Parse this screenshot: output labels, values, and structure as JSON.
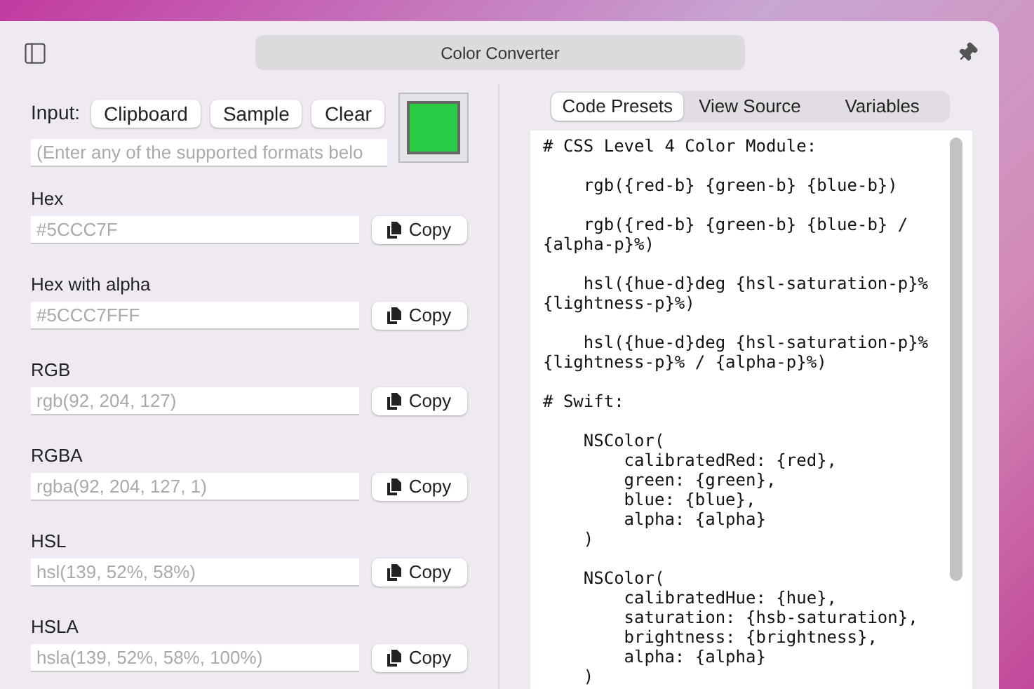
{
  "window": {
    "title": "Color Converter"
  },
  "input": {
    "label": "Input:",
    "buttons": [
      "Clipboard",
      "Sample",
      "Clear"
    ],
    "placeholder": "(Enter any of the supported formats belo",
    "color": "#29cc44"
  },
  "formats": [
    {
      "label": "Hex",
      "placeholder": "#5CCC7F",
      "button": "Copy"
    },
    {
      "label": "Hex with alpha",
      "placeholder": "#5CCC7FFF",
      "button": "Copy"
    },
    {
      "label": "RGB",
      "placeholder": "rgb(92, 204, 127)",
      "button": "Copy"
    },
    {
      "label": "RGBA",
      "placeholder": "rgba(92, 204, 127, 1)",
      "button": "Copy"
    },
    {
      "label": "HSL",
      "placeholder": "hsl(139, 52%, 58%)",
      "button": "Copy"
    },
    {
      "label": "HSLA",
      "placeholder": "hsla(139, 52%, 58%, 100%)",
      "button": "Copy"
    }
  ],
  "tabs": [
    {
      "label": "Code Presets",
      "selected": true
    },
    {
      "label": "View Source",
      "selected": false
    },
    {
      "label": "Variables",
      "selected": false
    }
  ],
  "code": "# CSS Level 4 Color Module:\n\n    rgb({red-b} {green-b} {blue-b})\n\n    rgb({red-b} {green-b} {blue-b} /\n{alpha-p}%)\n\n    hsl({hue-d}deg {hsl-saturation-p}%\n{lightness-p}%)\n\n    hsl({hue-d}deg {hsl-saturation-p}%\n{lightness-p}% / {alpha-p}%)\n\n# Swift:\n\n    NSColor(\n        calibratedRed: {red},\n        green: {green},\n        blue: {blue},\n        alpha: {alpha}\n    )\n\n    NSColor(\n        calibratedHue: {hue},\n        saturation: {hsb-saturation},\n        brightness: {brightness},\n        alpha: {alpha}\n    )"
}
